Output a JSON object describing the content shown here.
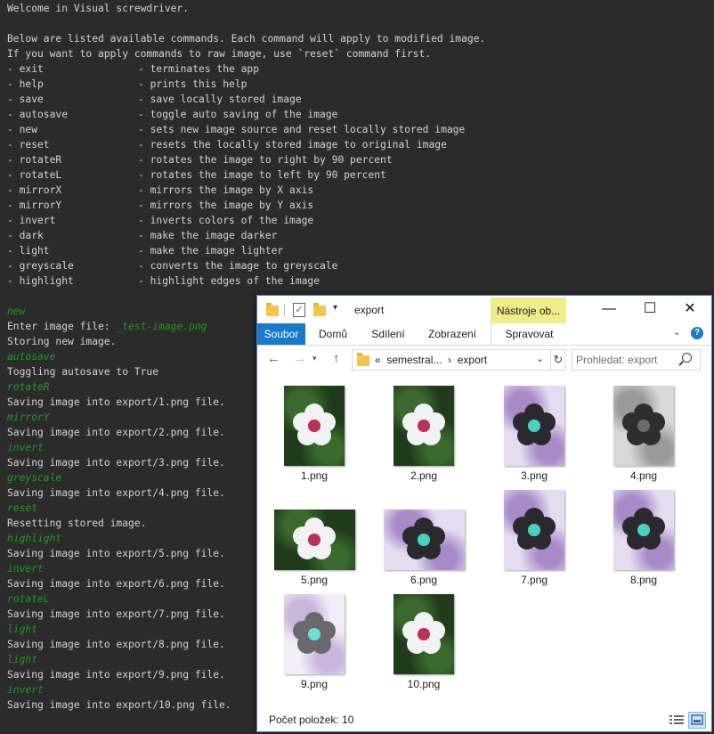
{
  "terminal": {
    "intro": [
      "Welcome in Visual screwdriver.",
      "",
      "Below are listed available commands. Each command will apply to modified image.",
      "If you want to apply commands to raw image, use `reset` command first."
    ],
    "commands": [
      {
        "name": "- exit",
        "desc": "- terminates the app"
      },
      {
        "name": "- help",
        "desc": "- prints this help"
      },
      {
        "name": "- save",
        "desc": "- save locally stored image"
      },
      {
        "name": "- autosave",
        "desc": "- toggle auto saving of the image"
      },
      {
        "name": "- new",
        "desc": "- sets new image source and reset locally stored image"
      },
      {
        "name": "- reset",
        "desc": "- resets the locally stored image to original image"
      },
      {
        "name": "- rotateR",
        "desc": "- rotates the image to right by 90 percent"
      },
      {
        "name": "- rotateL",
        "desc": "- rotates the image to left by 90 percent"
      },
      {
        "name": "- mirrorX",
        "desc": "- mirrors the image by X axis"
      },
      {
        "name": "- mirrorY",
        "desc": "- mirrors the image by Y axis"
      },
      {
        "name": "- invert",
        "desc": "- inverts colors of the image"
      },
      {
        "name": "- dark",
        "desc": "- make the image darker"
      },
      {
        "name": "- light",
        "desc": "- make the image lighter"
      },
      {
        "name": "- greyscale",
        "desc": "- converts the image to greyscale"
      },
      {
        "name": "- highlight",
        "desc": "- highlight edges of the image"
      }
    ],
    "session": [
      {
        "text": "new",
        "user": true
      },
      {
        "text": "Enter image file: ",
        "input": "_test-image.png"
      },
      {
        "text": "Storing new image."
      },
      {
        "text": "autosave",
        "user": true
      },
      {
        "text": "Toggling autosave to True"
      },
      {
        "text": "rotateR",
        "user": true
      },
      {
        "text": "Saving image into export/1.png file."
      },
      {
        "text": "mirrorY",
        "user": true
      },
      {
        "text": "Saving image into export/2.png file."
      },
      {
        "text": "invert",
        "user": true
      },
      {
        "text": "Saving image into export/3.png file."
      },
      {
        "text": "greyscale",
        "user": true
      },
      {
        "text": "Saving image into export/4.png file."
      },
      {
        "text": "reset",
        "user": true
      },
      {
        "text": "Resetting stored image."
      },
      {
        "text": "highlight",
        "user": true
      },
      {
        "text": "Saving image into export/5.png file."
      },
      {
        "text": "invert",
        "user": true
      },
      {
        "text": "Saving image into export/6.png file."
      },
      {
        "text": "rotateL",
        "user": true
      },
      {
        "text": "Saving image into export/7.png file."
      },
      {
        "text": "light",
        "user": true
      },
      {
        "text": "Saving image into export/8.png file."
      },
      {
        "text": "light",
        "user": true
      },
      {
        "text": "Saving image into export/9.png file."
      },
      {
        "text": "invert",
        "user": true
      },
      {
        "text": "Saving image into export/10.png file."
      }
    ]
  },
  "explorer": {
    "title": "export",
    "tools_tab": "Nástroje ob...",
    "window_buttons": {
      "minimize": "—",
      "maximize": "☐",
      "close": "✕"
    },
    "ribbon": {
      "file": "Soubor",
      "home": "Domů",
      "share": "Sdílení",
      "view": "Zobrazení",
      "manage": "Spravovat"
    },
    "address": {
      "prefix": "«",
      "parent": "semestral...",
      "separator": "›",
      "current": "export"
    },
    "search": {
      "placeholder": "Prohledat: export"
    },
    "files": [
      {
        "name": "1.png",
        "style": "original"
      },
      {
        "name": "2.png",
        "style": "original"
      },
      {
        "name": "3.png",
        "style": "inverted"
      },
      {
        "name": "4.png",
        "style": "greyscale-inverted"
      },
      {
        "name": "5.png",
        "style": "original"
      },
      {
        "name": "6.png",
        "style": "inverted"
      },
      {
        "name": "7.png",
        "style": "inverted"
      },
      {
        "name": "8.png",
        "style": "inverted"
      },
      {
        "name": "9.png",
        "style": "inverted-light"
      },
      {
        "name": "10.png",
        "style": "original"
      }
    ],
    "status": {
      "count": "Počet položek: 10"
    }
  }
}
